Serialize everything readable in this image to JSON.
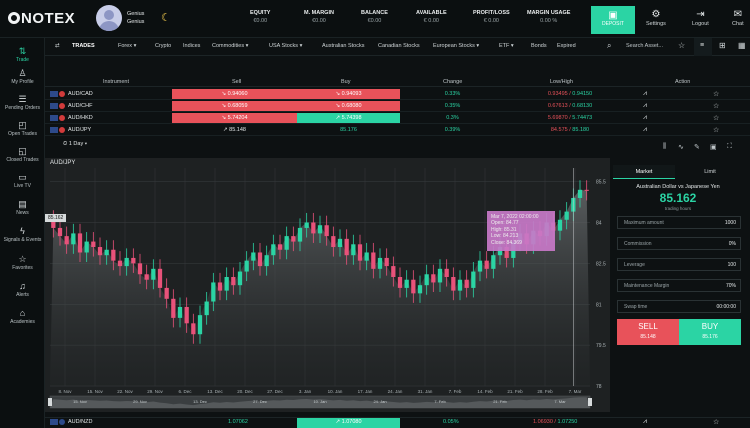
{
  "header": {
    "logo": "ONOTEX",
    "user": {
      "line1": "Genius",
      "line2": "Genius"
    },
    "stats": [
      {
        "label": "EQUITY",
        "value": "€0.00"
      },
      {
        "label": "M. MARGIN",
        "value": "€0.00"
      },
      {
        "label": "BALANCE",
        "value": "€0.00"
      },
      {
        "label": "AVAILABLE",
        "value": "€ 0.00"
      },
      {
        "label": "PROFIT/LOSS",
        "value": "€ 0.00"
      },
      {
        "label": "MARGIN USAGE",
        "value": "0.00 %"
      }
    ],
    "deposit_label": "DEPOSIT",
    "settings_label": "Settings",
    "logout_label": "Logout",
    "chat_label": "Chat"
  },
  "sidebar": {
    "items": [
      {
        "label": "Trade",
        "icon": "trade-icon"
      },
      {
        "label": "My Profile",
        "icon": "user-icon"
      },
      {
        "label": "Pending Orders",
        "icon": "pending-icon"
      },
      {
        "label": "Open Trades",
        "icon": "open-trades-icon"
      },
      {
        "label": "Closed Trades",
        "icon": "closed-trades-icon"
      },
      {
        "label": "Live TV",
        "icon": "tv-icon"
      },
      {
        "label": "News",
        "icon": "news-icon"
      },
      {
        "label": "Signals & Events",
        "icon": "signals-icon"
      },
      {
        "label": "Favorites",
        "icon": "star-icon"
      },
      {
        "label": "Alerts",
        "icon": "bell-icon"
      },
      {
        "label": "Academies",
        "icon": "academy-icon"
      }
    ]
  },
  "categories": {
    "trades": "TRADES",
    "items": [
      "Forex",
      "Crypto",
      "Indices",
      "Commodities",
      "USA Stocks",
      "Australian Stocks",
      "Canadian Stocks",
      "European Stocks",
      "ETF",
      "Bonds",
      "Expired"
    ],
    "search_placeholder": "Search Asset..."
  },
  "table": {
    "headers": [
      "Instrument",
      "Sell",
      "Buy",
      "Change",
      "Low/High",
      "Action"
    ],
    "rows": [
      {
        "symbol": "AUD/CAD",
        "sell": "0.94060",
        "buy": "0.94093",
        "change": "0.33%",
        "low": "0.93495",
        "high": "0.94150"
      },
      {
        "symbol": "AUD/CHF",
        "sell": "0.68059",
        "buy": "0.68080",
        "change": "0.35%",
        "low": "0.67613",
        "high": "0.68130"
      },
      {
        "symbol": "AUD/HKD",
        "sell": "5.74204",
        "buy": "5.74398",
        "change": "0.3%",
        "low": "5.69870",
        "high": "5.74473"
      },
      {
        "symbol": "AUD/JPY",
        "sell": "85.148",
        "buy": "85.176",
        "change": "0.39%",
        "low": "84.575",
        "high": "85.180"
      }
    ],
    "bottom_row": {
      "symbol": "AUD/NZD",
      "sell": "1.07062",
      "buy": "1.07080",
      "change": "0.05%",
      "low": "1.06930",
      "high": "1.07250"
    }
  },
  "chart": {
    "title": "AUD/JPY",
    "period": "1 Day",
    "last_price_tag": "85.162",
    "tooltip": {
      "date": "Mar 7, 2022 02:00:00",
      "open": "Open: 84.77",
      "high": "High: 85.31",
      "low": "Low: 84.213",
      "close": "Close: 84.369"
    },
    "y_ticks": [
      "85.5",
      "84",
      "82.5",
      "81",
      "79.5",
      "78"
    ],
    "x_ticks": [
      "8. Nov",
      "15. Nov",
      "22. Nov",
      "29. Nov",
      "6. Dec",
      "13. Dec",
      "20. Dec",
      "27. Dec",
      "3. Jan",
      "10. Jan",
      "17. Jan",
      "24. Jan",
      "31. Jan",
      "7. Feb",
      "14. Feb",
      "21. Feb",
      "28. Feb",
      "7. Mar"
    ],
    "nav_ticks": [
      "15. Nov",
      "29. Nov",
      "13. Dec",
      "27. Dec",
      "10. Jan",
      "24. Jan",
      "7. Feb",
      "21. Feb",
      "7. Mar"
    ]
  },
  "chart_data": {
    "type": "candlestick",
    "title": "AUD/JPY",
    "x_range": [
      "8. Nov",
      "7. Mar"
    ],
    "ylim": [
      78,
      86
    ],
    "grid": true,
    "closes": [
      83.8,
      83.5,
      83.2,
      83.6,
      82.9,
      83.3,
      83.1,
      82.8,
      83.0,
      82.6,
      82.4,
      82.7,
      82.5,
      82.1,
      81.9,
      82.3,
      81.6,
      81.2,
      80.5,
      80.9,
      80.3,
      79.9,
      80.6,
      81.1,
      81.8,
      81.5,
      82.0,
      81.7,
      82.2,
      82.6,
      82.9,
      82.4,
      82.8,
      83.2,
      83.0,
      83.5,
      83.3,
      83.8,
      84.0,
      83.6,
      83.9,
      83.5,
      83.1,
      83.4,
      82.8,
      83.2,
      82.6,
      82.9,
      82.3,
      82.7,
      82.4,
      82.0,
      81.6,
      81.9,
      81.4,
      81.7,
      82.1,
      81.8,
      82.3,
      82.0,
      81.5,
      81.9,
      81.6,
      82.2,
      82.6,
      82.3,
      82.8,
      83.1,
      82.7,
      83.3,
      83.6,
      83.2,
      83.7,
      83.5,
      84.0,
      83.7,
      84.1,
      84.4,
      84.9,
      85.2,
      85.16
    ]
  },
  "order_panel": {
    "tabs": [
      "Market",
      "Limit"
    ],
    "instrument_name": "Australian Dollar vs Japanese Yen",
    "price": "85.162",
    "price_sub": "trading hours",
    "fields": [
      {
        "label": "Maximum amount",
        "value": "1000"
      },
      {
        "label": "Commission",
        "value": "0%"
      },
      {
        "label": "Leverage",
        "value": "100"
      },
      {
        "label": "Maintenance Margin",
        "value": "70%"
      },
      {
        "label": "Swap time",
        "value": "00:00:00"
      }
    ],
    "sell_label": "SELL",
    "sell_price": "85.148",
    "buy_label": "BUY",
    "buy_price": "85.176"
  }
}
